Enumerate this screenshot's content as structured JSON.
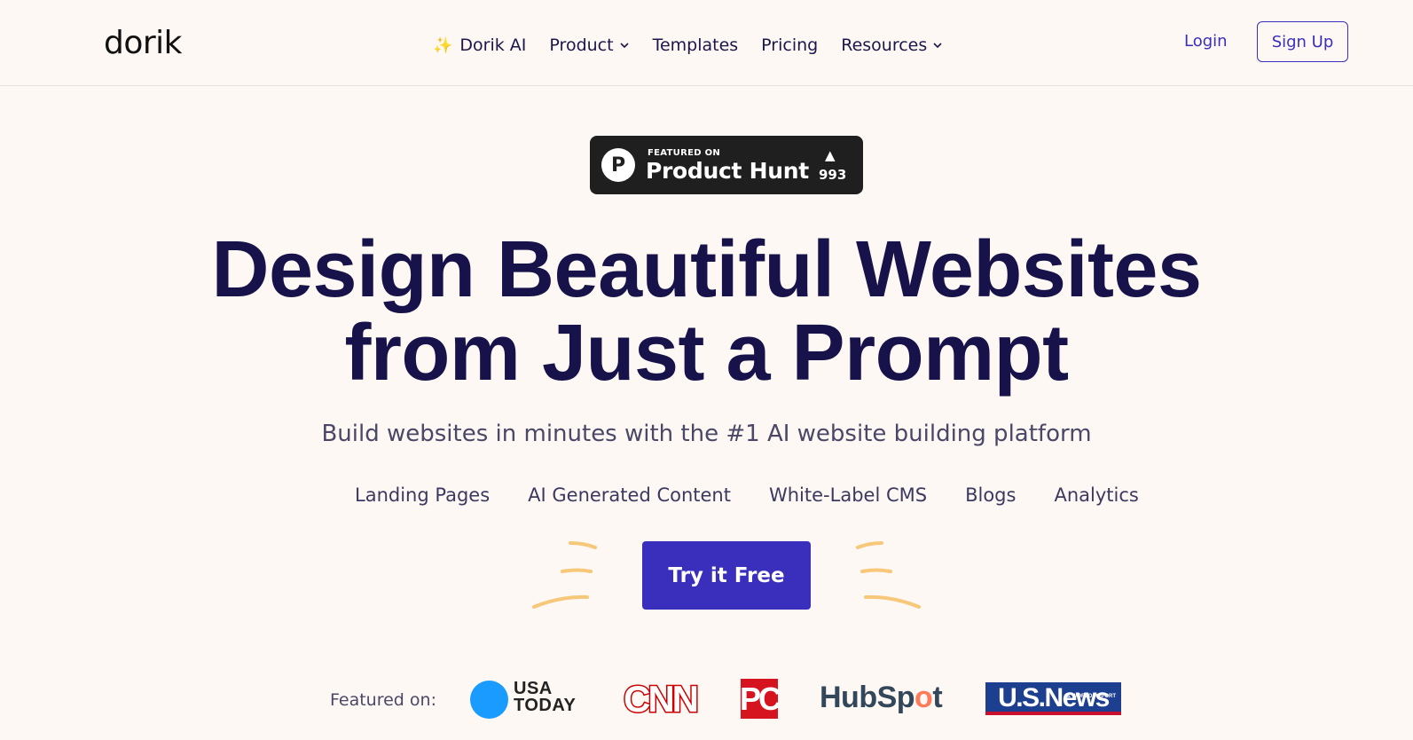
{
  "header": {
    "logo_text": "dorik",
    "nav": [
      {
        "label": "Dorik AI",
        "icon": "sparkle-icon"
      },
      {
        "label": "Product",
        "icon": "chevron-down-icon"
      },
      {
        "label": "Templates"
      },
      {
        "label": "Pricing"
      },
      {
        "label": "Resources",
        "icon": "chevron-down-icon"
      }
    ],
    "login_label": "Login",
    "signup_label": "Sign Up"
  },
  "product_hunt": {
    "featured_on": "FEATURED ON",
    "name": "Product Hunt",
    "letter": "P",
    "arrow": "▲",
    "votes": "993"
  },
  "hero": {
    "line1": "Design Beautiful Websites",
    "line2": "from Just a Prompt",
    "subtitle": "Build websites in minutes with the #1 AI website building platform",
    "features": [
      "Landing Pages",
      "AI Generated Content",
      "White-Label CMS",
      "Blogs",
      "Analytics"
    ],
    "cta_label": "Try it Free"
  },
  "featured": {
    "label": "Featured on:",
    "logos": {
      "usa_today_line1": "USA",
      "usa_today_line2": "TODAY",
      "cnn": "CNN",
      "pc": "PC",
      "hubspot_pre": "HubSp",
      "hubspot_dot": "o",
      "hubspot_post": "t",
      "usnews": "U.S.News",
      "usnews_small": "& WORLD REPORT"
    }
  },
  "colors": {
    "background": "#fdf8f3",
    "primary": "#3a2fbd",
    "heading": "#17134a",
    "deco": "#f7c77a"
  }
}
